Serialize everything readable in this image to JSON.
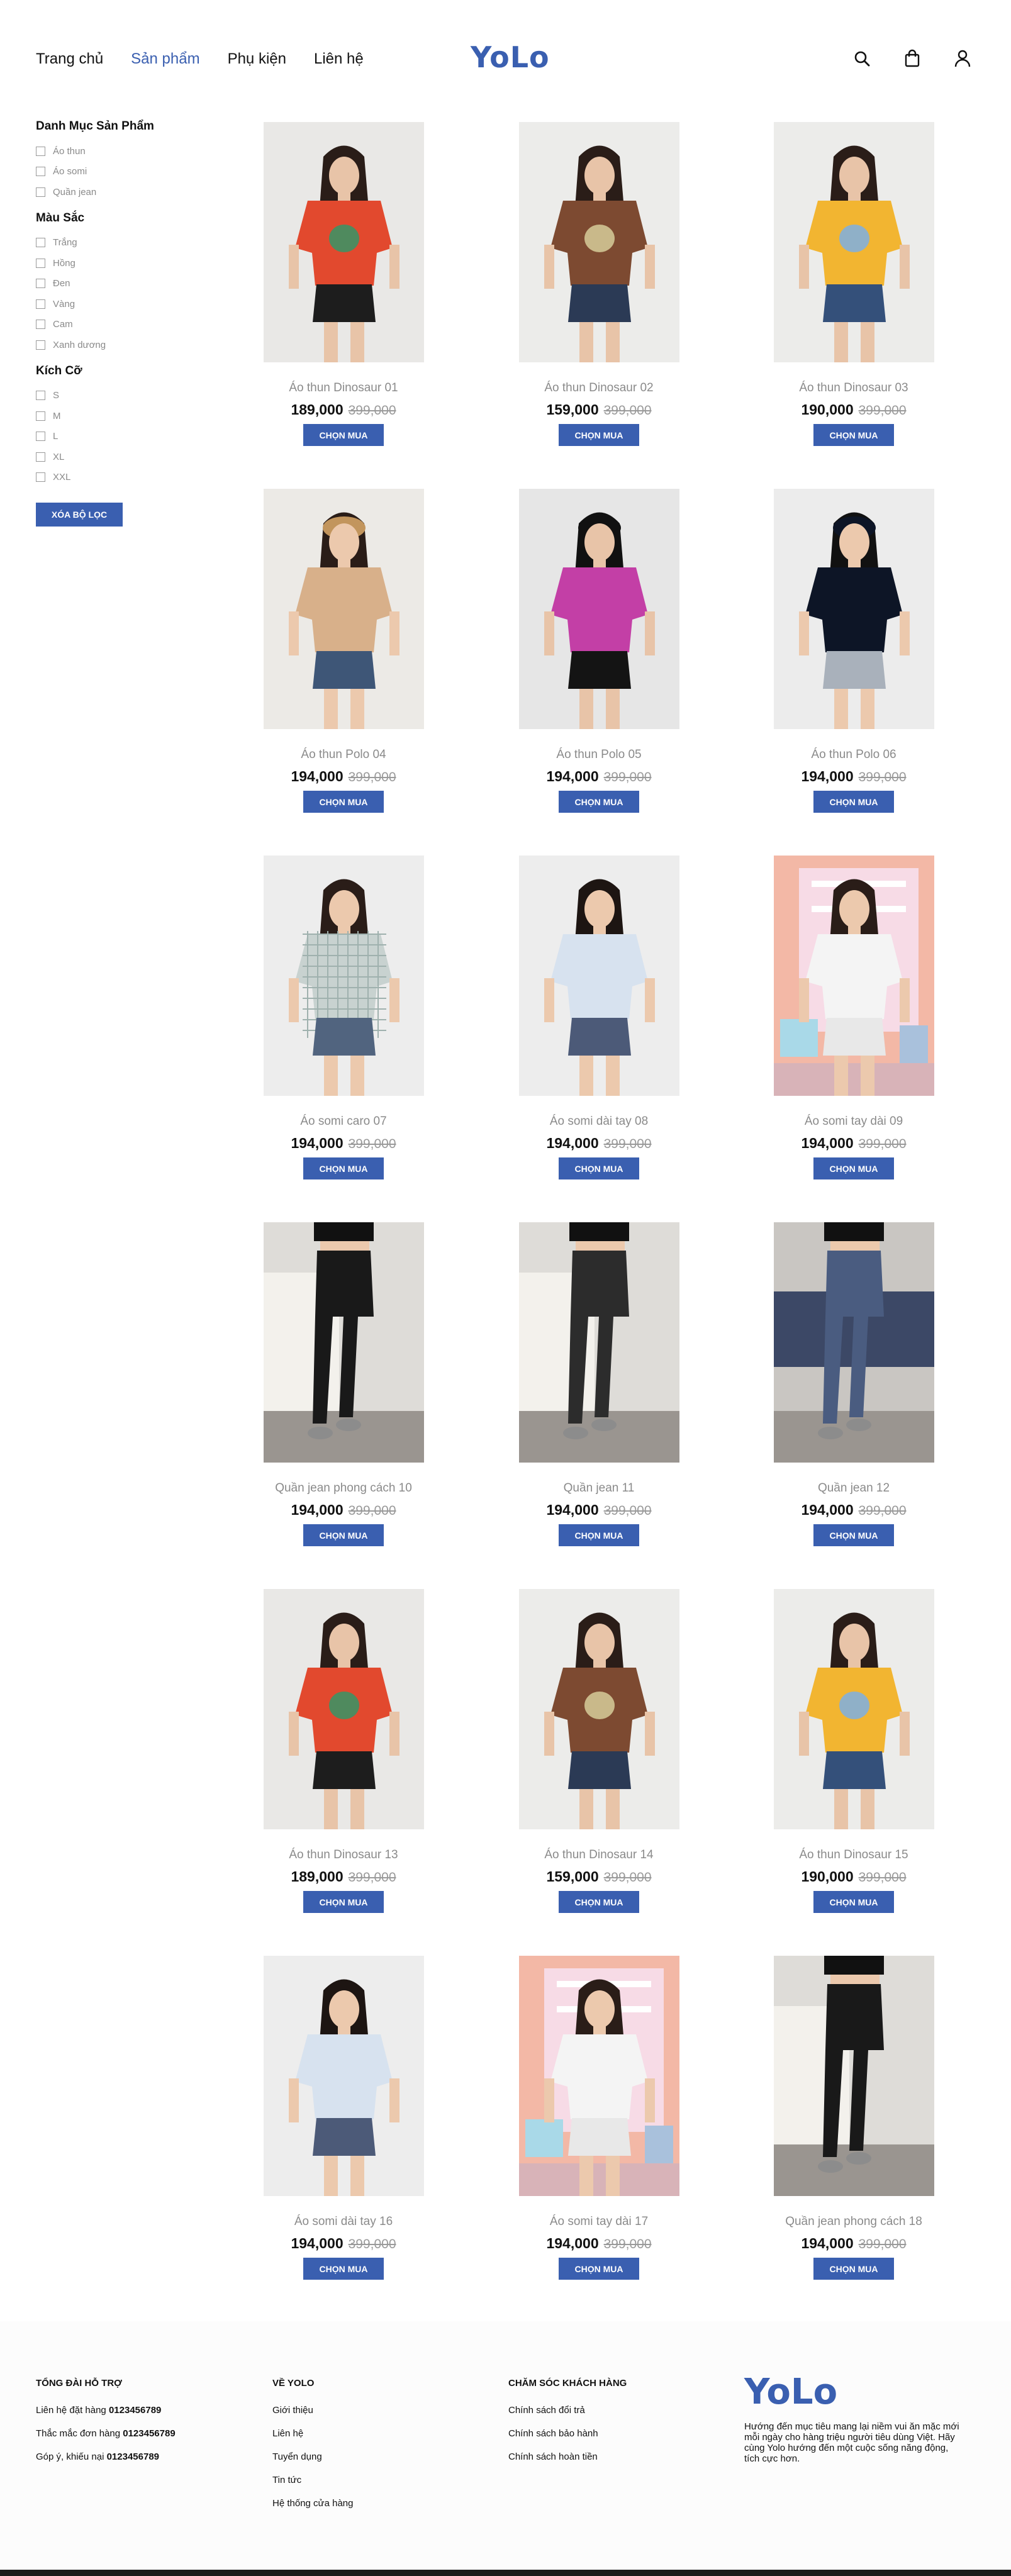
{
  "header": {
    "nav": [
      "Trang chủ",
      "Sản phẩm",
      "Phụ kiện",
      "Liên hệ"
    ],
    "active_nav": "Sản phẩm",
    "logo": "YoLo",
    "icons": [
      "search-icon",
      "shopping-bag-icon",
      "user-icon"
    ]
  },
  "sidebar": {
    "category_title": "Danh Mục Sản Phẩm",
    "categories": [
      "Áo thun",
      "Áo somi",
      "Quần jean"
    ],
    "color_title": "Màu Sắc",
    "colors": [
      "Trắng",
      "Hồng",
      "Đen",
      "Vàng",
      "Cam",
      "Xanh dương"
    ],
    "size_title": "Kích Cỡ",
    "sizes": [
      "S",
      "M",
      "L",
      "XL",
      "XXL"
    ],
    "clear_label": "XÓA BỘ LỌC"
  },
  "products": [
    {
      "name": "Áo thun Dinosaur 01",
      "price": "189,000",
      "old_price": "399,000",
      "buy": "CHỌN MUA",
      "look": "orange"
    },
    {
      "name": "Áo thun Dinosaur 02",
      "price": "159,000",
      "old_price": "399,000",
      "buy": "CHỌN MUA",
      "look": "brown"
    },
    {
      "name": "Áo thun Dinosaur 03",
      "price": "190,000",
      "old_price": "399,000",
      "buy": "CHỌN MUA",
      "look": "yellow"
    },
    {
      "name": "Áo thun Polo 04",
      "price": "194,000",
      "old_price": "399,000",
      "buy": "CHỌN MUA",
      "look": "beige"
    },
    {
      "name": "Áo thun Polo 05",
      "price": "194,000",
      "old_price": "399,000",
      "buy": "CHỌN MUA",
      "look": "magenta"
    },
    {
      "name": "Áo thun Polo 06",
      "price": "194,000",
      "old_price": "399,000",
      "buy": "CHỌN MUA",
      "look": "navy"
    },
    {
      "name": "Áo somi caro 07",
      "price": "194,000",
      "old_price": "399,000",
      "buy": "CHỌN MUA",
      "look": "plaid"
    },
    {
      "name": "Áo somi dài tay 08",
      "price": "194,000",
      "old_price": "399,000",
      "buy": "CHỌN MUA",
      "look": "shirt"
    },
    {
      "name": "Áo somi tay dài 09",
      "price": "194,000",
      "old_price": "399,000",
      "buy": "CHỌN MUA",
      "look": "pink"
    },
    {
      "name": "Quần jean phong cách 10",
      "price": "194,000",
      "old_price": "399,000",
      "buy": "CHỌN MUA",
      "look": "jeans-black"
    },
    {
      "name": "Quần jean 11",
      "price": "194,000",
      "old_price": "399,000",
      "buy": "CHỌN MUA",
      "look": "jeans-dark"
    },
    {
      "name": "Quần jean 12",
      "price": "194,000",
      "old_price": "399,000",
      "buy": "CHỌN MUA",
      "look": "jeans-blue"
    },
    {
      "name": "Áo thun Dinosaur 13",
      "price": "189,000",
      "old_price": "399,000",
      "buy": "CHỌN MUA",
      "look": "orange"
    },
    {
      "name": "Áo thun Dinosaur 14",
      "price": "159,000",
      "old_price": "399,000",
      "buy": "CHỌN MUA",
      "look": "brown"
    },
    {
      "name": "Áo thun Dinosaur 15",
      "price": "190,000",
      "old_price": "399,000",
      "buy": "CHỌN MUA",
      "look": "yellow"
    },
    {
      "name": "Áo somi dài tay 16",
      "price": "194,000",
      "old_price": "399,000",
      "buy": "CHỌN MUA",
      "look": "shirt"
    },
    {
      "name": "Áo somi tay dài 17",
      "price": "194,000",
      "old_price": "399,000",
      "buy": "CHỌN MUA",
      "look": "pink"
    },
    {
      "name": "Quần jean phong cách 18",
      "price": "194,000",
      "old_price": "399,000",
      "buy": "CHỌN MUA",
      "look": "jeans-black"
    }
  ],
  "footer": {
    "support_title": "TỔNG ĐÀI HỖ TRỢ",
    "support_lines": [
      {
        "label": "Liên hệ đặt hàng",
        "phone": "0123456789"
      },
      {
        "label": "Thắc mắc đơn hàng",
        "phone": "0123456789"
      },
      {
        "label": "Góp ý, khiếu nại",
        "phone": "0123456789"
      }
    ],
    "about_title": "VỀ YOLO",
    "about_links": [
      "Giới thiệu",
      "Liên hệ",
      "Tuyển dụng",
      "Tin tức",
      "Hệ thống cửa hàng"
    ],
    "care_title": "CHĂM SÓC KHÁCH HÀNG",
    "care_links": [
      "Chính sách đổi trả",
      "Chính sách bảo hành",
      "Chính sách hoàn tiền"
    ],
    "logo": "YoLo",
    "description": "Hướng đến mục tiêu mang lại niềm vui ăn mặc mới mỗi ngày cho hàng triệu người tiêu dùng Việt. Hãy cùng Yolo hướng đến một cuộc sống năng động, tích cực hơn."
  },
  "colors": {
    "accent": "#3a5fb0",
    "text": "#111111",
    "muted": "#8a8a8a"
  }
}
